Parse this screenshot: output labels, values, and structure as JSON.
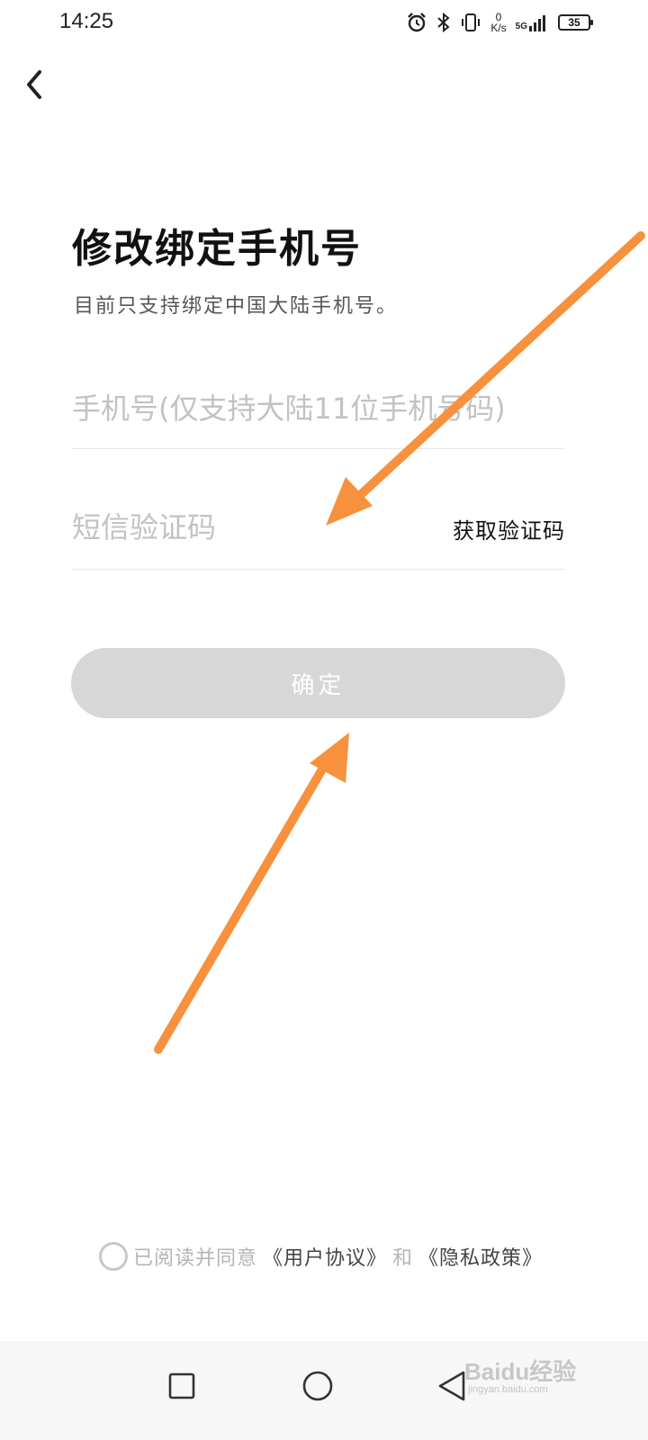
{
  "status_bar": {
    "time": "14:25",
    "net_speed_value": "0",
    "net_speed_unit": "K/s",
    "net_type": "5G",
    "battery": "35"
  },
  "header": {
    "title": "修改绑定手机号",
    "subtitle": "目前只支持绑定中国大陆手机号。"
  },
  "form": {
    "phone_placeholder": "手机号(仅支持大陆11位手机号码)",
    "sms_placeholder": "短信验证码",
    "get_code_label": "获取验证码",
    "confirm_label": "确定"
  },
  "agreement": {
    "prefix": "已阅读并同意",
    "user_agreement": "《用户协议》",
    "and": "和",
    "privacy_policy": "《隐私政策》"
  },
  "watermark": {
    "brand": "Baidu经验",
    "url": "jingyan.baidu.com"
  },
  "colors": {
    "annotation_arrow": "#f7913d",
    "confirm_disabled": "#d7d7d7",
    "placeholder": "#c2c2c2"
  },
  "icons": {
    "status": [
      "alarm-icon",
      "bluetooth-icon",
      "vibrate-icon",
      "signal-icon",
      "battery-icon"
    ],
    "nav": [
      "recent-apps-icon",
      "home-icon",
      "back-triangle-icon"
    ]
  }
}
